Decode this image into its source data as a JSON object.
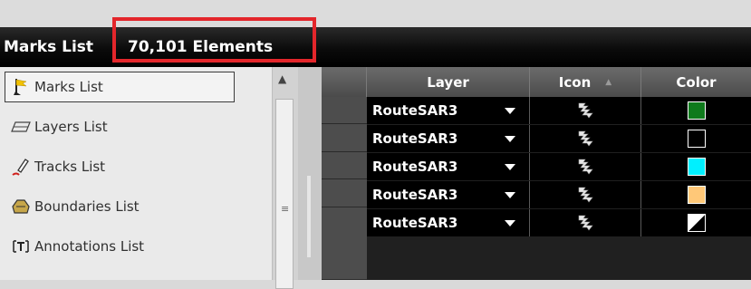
{
  "header": {
    "title": "Marks List",
    "element_count": "70,101 Elements",
    "highlight_color": "#e3262b"
  },
  "sidebar": {
    "items": [
      {
        "label": "Marks List",
        "icon": "flag-icon",
        "selected": true
      },
      {
        "label": "Layers List",
        "icon": "layers-icon",
        "selected": false
      },
      {
        "label": "Tracks List",
        "icon": "track-pen-icon",
        "selected": false
      },
      {
        "label": "Boundaries List",
        "icon": "boundary-icon",
        "selected": false
      },
      {
        "label": "Annotations List",
        "icon": "annotation-text-icon",
        "selected": false
      }
    ]
  },
  "table": {
    "columns": [
      "Layer",
      "Icon",
      "Color"
    ],
    "rows": [
      {
        "layer": "RouteSAR3",
        "icon": "sar-route-icon",
        "color": "#0f7a1c"
      },
      {
        "layer": "RouteSAR3",
        "icon": "sar-route-icon",
        "color": "#000000"
      },
      {
        "layer": "RouteSAR3",
        "icon": "sar-route-icon",
        "color": "#00f0ff"
      },
      {
        "layer": "RouteSAR3",
        "icon": "sar-route-icon",
        "color": "#ffc878"
      },
      {
        "layer": "RouteSAR3",
        "icon": "sar-route-icon",
        "color": "split-black-white"
      }
    ]
  }
}
